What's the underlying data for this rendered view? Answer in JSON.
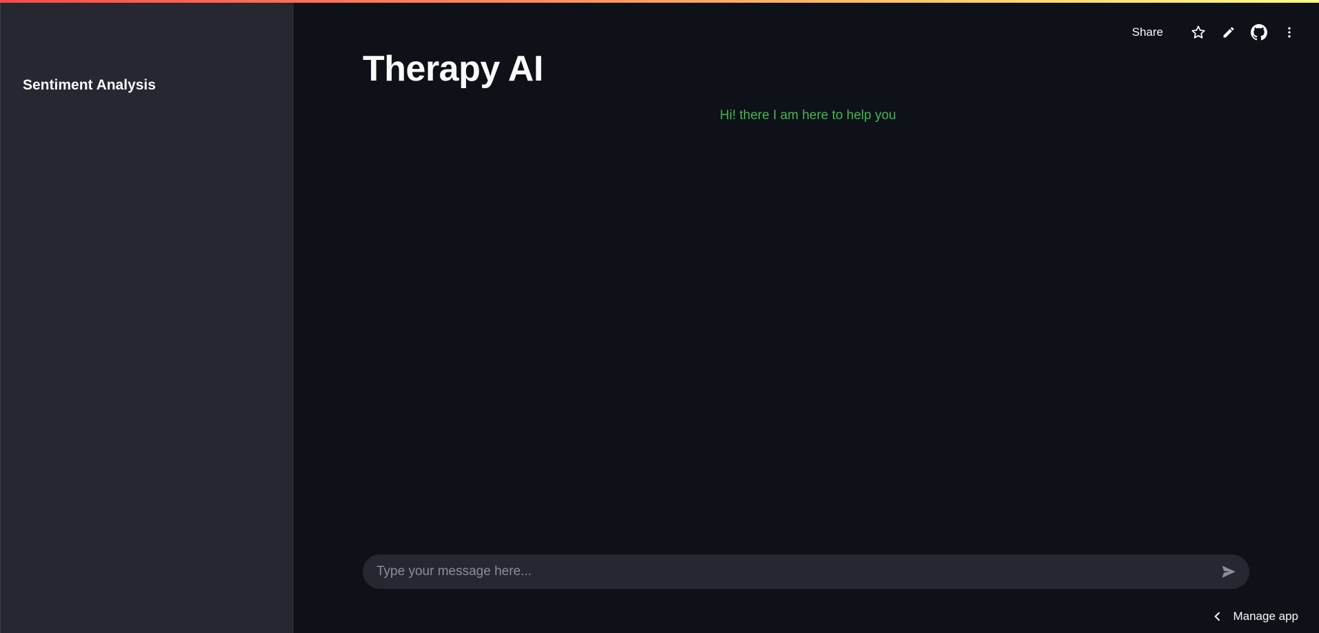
{
  "sidebar": {
    "title": "Sentiment Analysis"
  },
  "toolbar": {
    "share_label": "Share",
    "icons": [
      "star-icon",
      "pencil-icon",
      "github-icon",
      "more-vertical-icon"
    ]
  },
  "main": {
    "title": "Therapy AI",
    "greeting": "Hi! there I am here to help you"
  },
  "chat_input": {
    "placeholder": "Type your message here...",
    "value": ""
  },
  "footer": {
    "manage_app_label": "Manage app"
  },
  "colors": {
    "background": "#0e1117",
    "sidebar": "#262730",
    "greeting": "#3fb950",
    "text": "#fafafa"
  }
}
